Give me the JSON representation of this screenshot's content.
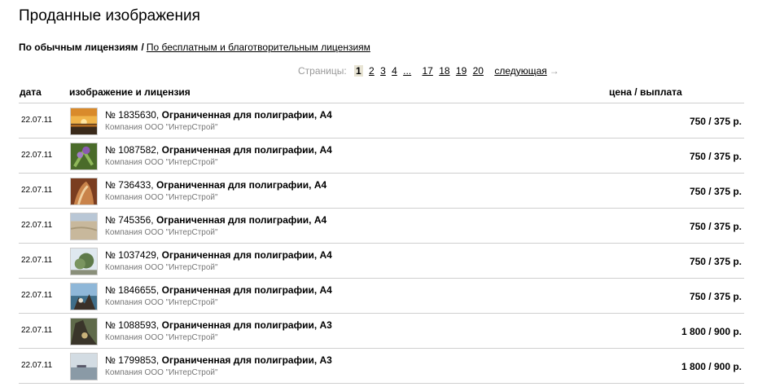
{
  "page": {
    "title": "Проданные изображения"
  },
  "tabs": {
    "active_label": "По обычным лицензиям",
    "separator": "/",
    "other_label": "По бесплатным и благотворительным лицензиям"
  },
  "pager": {
    "label": "Страницы:",
    "current": "1",
    "pages": [
      "2",
      "3",
      "4"
    ],
    "dots": "...",
    "tail_pages": [
      "17",
      "18",
      "19",
      "20"
    ],
    "next_label": "следующая",
    "arrow": "→"
  },
  "table": {
    "headers": {
      "date": "дата",
      "image": "изображение и лицензия",
      "price": "цена / выплата"
    },
    "rows": [
      {
        "date": "22.07.11",
        "number": "№ 1835630,",
        "license": "Ограниченная для полиграфии, А4",
        "company": "Компания ООО \"ИнтерСтрой\"",
        "price": "750 / 375 р.",
        "thumb": "sunset"
      },
      {
        "date": "22.07.11",
        "number": "№ 1087582,",
        "license": "Ограниченная для полиграфии, А4",
        "company": "Компания ООО \"ИнтерСтрой\"",
        "price": "750 / 375 р.",
        "thumb": "flower"
      },
      {
        "date": "22.07.11",
        "number": "№ 736433,",
        "license": "Ограниченная для полиграфии, А4",
        "company": "Компания ООО \"ИнтерСтрой\"",
        "price": "750 / 375 р.",
        "thumb": "bark"
      },
      {
        "date": "22.07.11",
        "number": "№ 745356,",
        "license": "Ограниченная для полиграфии, А4",
        "company": "Компания ООО \"ИнтерСтрой\"",
        "price": "750 / 375 р.",
        "thumb": "beach"
      },
      {
        "date": "22.07.11",
        "number": "№ 1037429,",
        "license": "Ограниченная для полиграфии, А4",
        "company": "Компания ООО \"ИнтерСтрой\"",
        "price": "750 / 375 р.",
        "thumb": "tree"
      },
      {
        "date": "22.07.11",
        "number": "№ 1846655,",
        "license": "Ограниченная для полиграфии, А4",
        "company": "Компания ООО \"ИнтерСтрой\"",
        "price": "750 / 375 р.",
        "thumb": "rocks"
      },
      {
        "date": "22.07.11",
        "number": "№ 1088593,",
        "license": "Ограниченная для полиграфии, А3",
        "company": "Компания ООО \"ИнтерСтрой\"",
        "price": "1 800 / 900 р.",
        "thumb": "cliff"
      },
      {
        "date": "22.07.11",
        "number": "№ 1799853,",
        "license": "Ограниченная для полиграфии, А3",
        "company": "Компания ООО \"ИнтерСтрой\"",
        "price": "1 800 / 900 р.",
        "thumb": "sea"
      }
    ]
  }
}
